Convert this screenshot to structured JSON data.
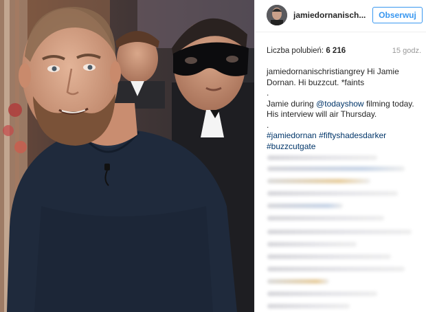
{
  "post": {
    "username": "jamiedornanisch...",
    "follow_label": "Obserwuj",
    "likes_label": "Liczba polubień:",
    "likes_count": "6 216",
    "time_ago": "15 godz.",
    "caption": {
      "author": "jamiedornanischristiangrey",
      "line1_text": " Hi Jamie",
      "line2": "Dornan. Hi buzzcut. *faints",
      "dot1": ".",
      "line3_pre": "Jamie during ",
      "mention": "@todayshow",
      "line3_post": " filming today.",
      "line4": "His interview will air Thursday.",
      "dot2": ".",
      "hashtag1": "#jamiedornan",
      "hashtag2": "#fiftyshadesdarker",
      "hashtag3": "#buzzcutgate"
    }
  },
  "colors": {
    "link": "#003569",
    "follow": "#3897f0",
    "muted": "#999999",
    "text": "#262626"
  },
  "icons": {
    "avatar": "profile-avatar",
    "photo": "post-photo"
  }
}
